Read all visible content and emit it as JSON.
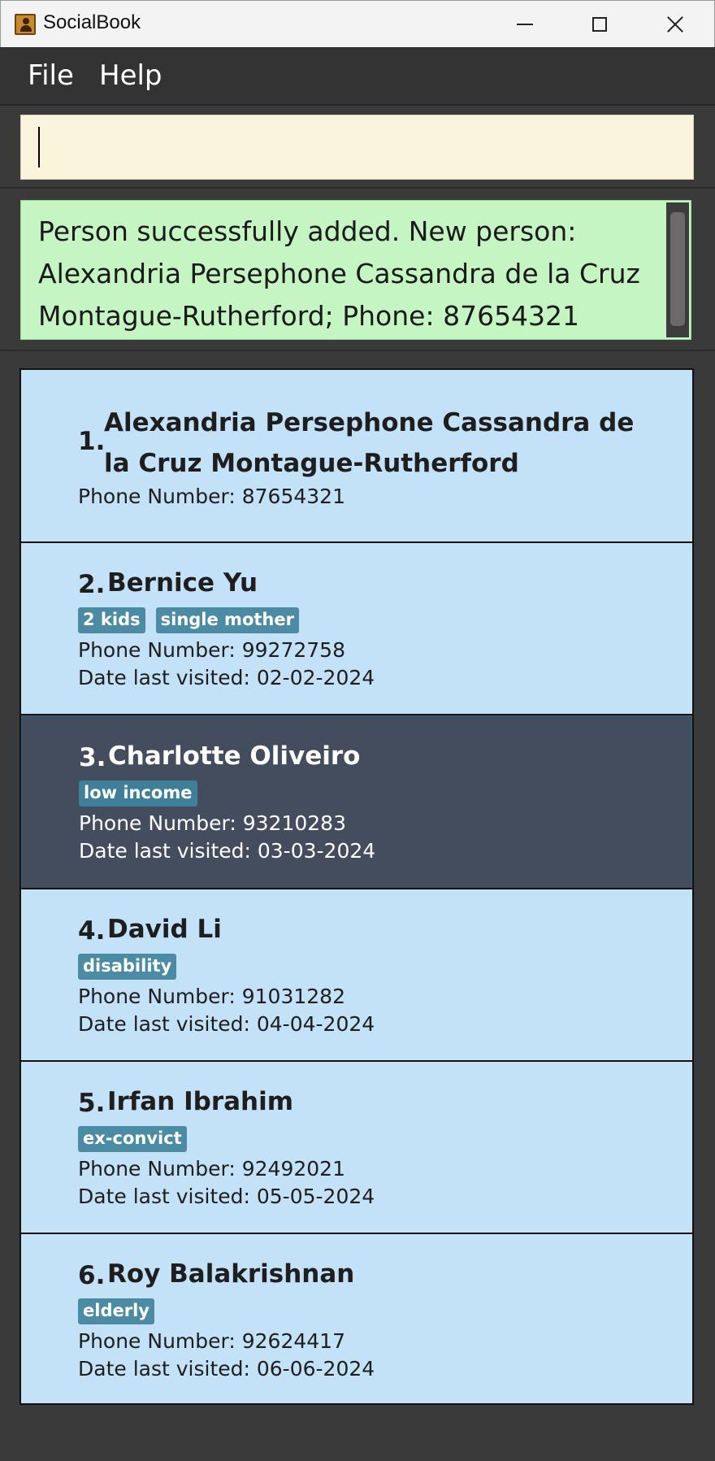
{
  "window": {
    "title": "SocialBook"
  },
  "menu": {
    "file": "File",
    "help": "Help"
  },
  "command": {
    "value": "",
    "placeholder": ""
  },
  "result": {
    "message": "Person successfully added. New person: Alexandria Persephone Cassandra de la Cruz Montague-Rutherford; Phone: 87654321"
  },
  "persons": [
    {
      "index": "1.",
      "name": "Alexandria Persephone Cassandra de la Cruz Montague-Rutherford",
      "tags": [],
      "phone": "Phone Number: 87654321",
      "visited": ""
    },
    {
      "index": "2.",
      "name": "Bernice Yu",
      "tags": [
        "2 kids",
        "single mother"
      ],
      "phone": "Phone Number: 99272758",
      "visited": "Date last visited: 02-02-2024"
    },
    {
      "index": "3.",
      "name": "Charlotte Oliveiro",
      "tags": [
        "low income"
      ],
      "phone": "Phone Number: 93210283",
      "visited": "Date last visited: 03-03-2024",
      "selected": true
    },
    {
      "index": "4.",
      "name": "David Li",
      "tags": [
        "disability"
      ],
      "phone": "Phone Number: 91031282",
      "visited": "Date last visited: 04-04-2024"
    },
    {
      "index": "5.",
      "name": "Irfan Ibrahim",
      "tags": [
        "ex-convict"
      ],
      "phone": "Phone Number: 92492021",
      "visited": "Date last visited: 05-05-2024"
    },
    {
      "index": "6.",
      "name": "Roy Balakrishnan",
      "tags": [
        "elderly"
      ],
      "phone": "Phone Number: 92624417",
      "visited": "Date last visited: 06-06-2024"
    }
  ]
}
